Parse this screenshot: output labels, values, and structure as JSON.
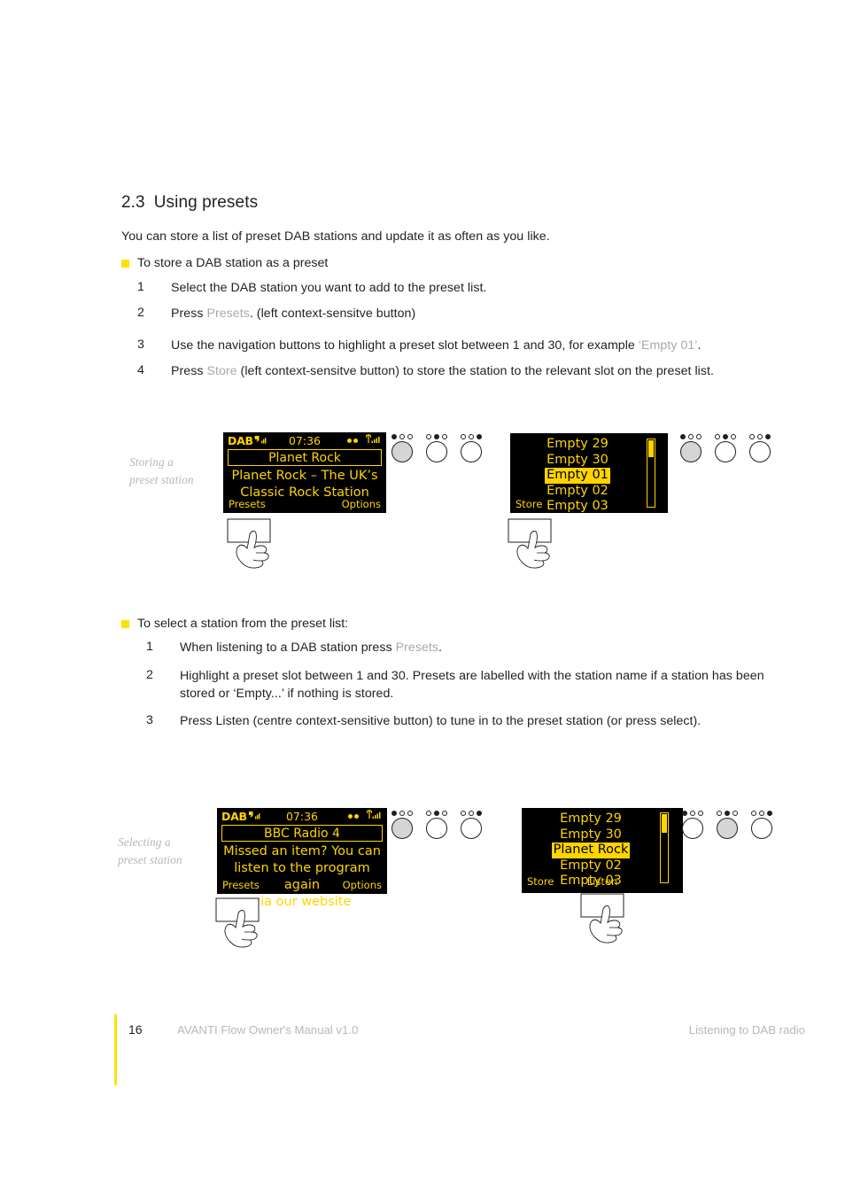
{
  "page": {
    "section_number": "2.3",
    "section_title": "Using presets",
    "intro": "You can store a list of preset DAB stations and update it as often as you like."
  },
  "procedure_store": {
    "heading": "To store a DAB station as a preset",
    "steps": [
      {
        "n": "1",
        "pre": "Select the DAB station you want to add to the preset list.",
        "dim": "",
        "post": ""
      },
      {
        "n": "2",
        "pre": "Press ",
        "dim": "Presets",
        "post": ". (left context-sensitve button)"
      },
      {
        "n": "3",
        "pre": "Use the navigation buttons to highlight a preset slot between 1 and 30, for example ",
        "dim": "‘Empty 01’",
        "post": "."
      },
      {
        "n": "4",
        "pre": "Press ",
        "dim": "Store",
        "post": " (left context-sensitve button) to store the station to the relevant slot on the preset list."
      }
    ]
  },
  "procedure_select": {
    "heading": "To select a station from the preset list:",
    "steps": [
      {
        "n": "1",
        "pre": "When listening to a DAB station press ",
        "dim": "Presets",
        "post": "."
      },
      {
        "n": "2",
        "pre": "Highlight a preset slot between 1 and 30. Presets are labelled with the station name if a station has been stored or ‘Empty...’ if nothing is stored.",
        "dim": "",
        "post": ""
      },
      {
        "n": "3",
        "pre": "Press Listen (centre context-sensitive button) to tune in to the preset station (or press select).",
        "dim": "",
        "post": ""
      }
    ]
  },
  "figure_storing": {
    "caption": "Storing a\npreset station",
    "screen_now_playing": {
      "mode": "DAB",
      "clock": "07:36",
      "station_title": "Planet Rock",
      "body_line1": "Planet Rock – The UK’s",
      "body_line2": "Classic Rock Station",
      "softkey_left": "Presets",
      "softkey_right": "Options",
      "icons": {
        "signal": "signal-bars-icon",
        "stereo": "stereo-icon",
        "antenna": "antenna-signal-icon"
      }
    },
    "button_cluster_1": {
      "buttons": [
        {
          "dots": [
            1,
            0,
            0
          ],
          "active": true
        },
        {
          "dots": [
            0,
            1,
            0
          ],
          "active": false
        },
        {
          "dots": [
            0,
            0,
            1
          ],
          "active": false
        }
      ]
    },
    "screen_preset_list": {
      "items": [
        "Empty 29",
        "Empty 30",
        "Empty 01",
        "Empty 02",
        "Empty 03"
      ],
      "selected_index": 2,
      "softkey_left": "Store",
      "softkey_center": "",
      "scroll_thumb_position": "top"
    },
    "button_cluster_2": {
      "buttons": [
        {
          "dots": [
            1,
            0,
            0
          ],
          "active": true
        },
        {
          "dots": [
            0,
            1,
            0
          ],
          "active": false
        },
        {
          "dots": [
            0,
            0,
            1
          ],
          "active": false
        }
      ]
    }
  },
  "figure_selecting": {
    "caption": "Selecting a\npreset station",
    "screen_now_playing": {
      "mode": "DAB",
      "clock": "07:36",
      "station_title": "BBC Radio 4",
      "body_line1": "Missed an item? You can",
      "body_line2": "listen to the program again",
      "body_line3": "via our website",
      "softkey_left": "Presets",
      "softkey_right": "Options",
      "icons": {
        "signal": "signal-bars-icon",
        "stereo": "stereo-icon",
        "antenna": "antenna-signal-icon"
      }
    },
    "button_cluster_1": {
      "buttons": [
        {
          "dots": [
            1,
            0,
            0
          ],
          "active": true
        },
        {
          "dots": [
            0,
            1,
            0
          ],
          "active": false
        },
        {
          "dots": [
            0,
            0,
            1
          ],
          "active": false
        }
      ]
    },
    "screen_preset_list": {
      "items": [
        "Empty 29",
        "Empty 30",
        "Planet Rock",
        "Empty 02",
        "Empty 03"
      ],
      "selected_index": 2,
      "softkey_left": "Store",
      "softkey_center": "Listen",
      "scroll_thumb_position": "top"
    },
    "button_cluster_2": {
      "buttons": [
        {
          "dots": [
            1,
            0,
            0
          ],
          "active": false
        },
        {
          "dots": [
            0,
            1,
            0
          ],
          "active": true
        },
        {
          "dots": [
            0,
            0,
            1
          ],
          "active": false
        }
      ]
    }
  },
  "footer": {
    "page_number": "16",
    "left_text": "AVANTI Flow Owner's Manual v1.0",
    "right_text": "Listening to DAB radio"
  },
  "colors": {
    "accent_yellow": "#ffe000",
    "lcd_yellow": "#ffd400",
    "lcd_bg": "#000000",
    "body_text": "#231f20",
    "dim_text": "#a7a9ac"
  }
}
